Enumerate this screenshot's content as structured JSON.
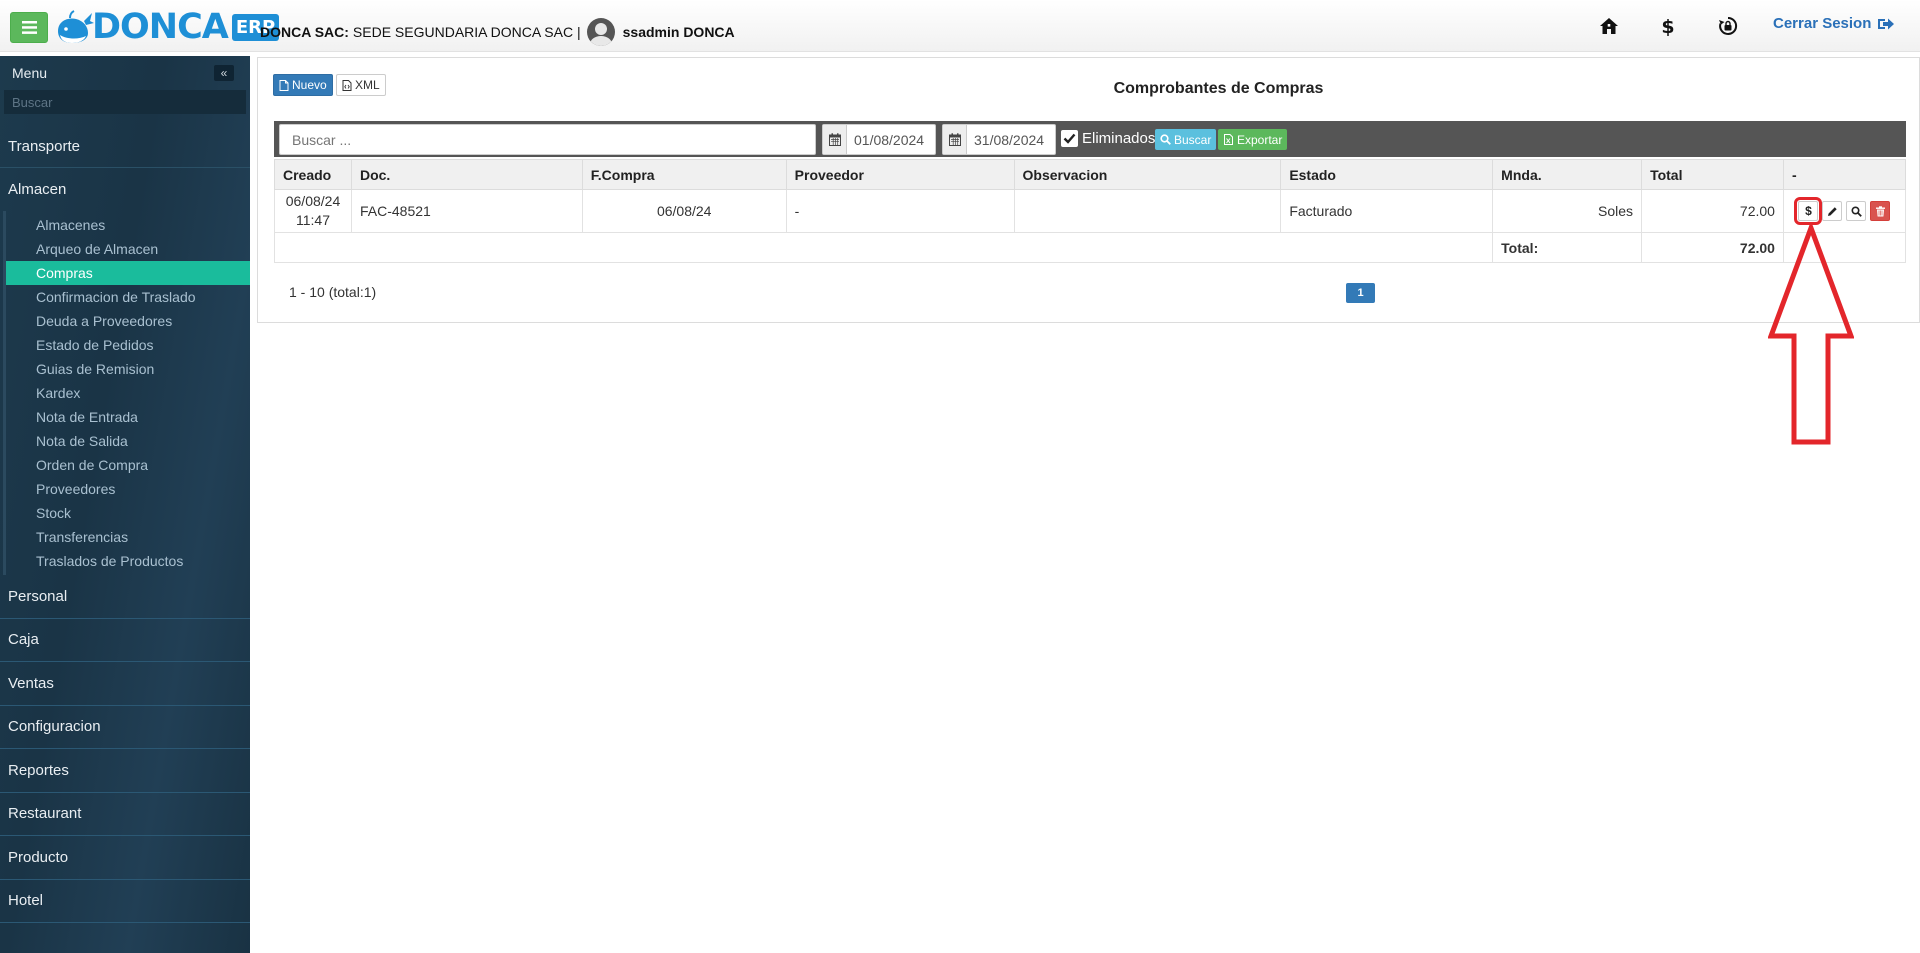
{
  "topbar": {
    "menu_icon": "hamburger-icon",
    "logo_text": "DONCA",
    "logo_badge": "ERP",
    "company_label": "DONCA SAC:",
    "branch": "SEDE SEGUNDARIA DONCA SAC |",
    "user": "ssadmin DONCA",
    "icons": [
      "home-icon",
      "dollar-icon",
      "lock-rotate-icon"
    ],
    "logout_label": "Cerrar Sesion"
  },
  "sidebar": {
    "title": "Menu",
    "collapse_icon": "double-chevron-left-icon",
    "search_placeholder": "Buscar",
    "top_items": [
      "Transporte",
      "Almacen"
    ],
    "almacen_items": [
      "Almacenes",
      "Arqueo de Almacen",
      "Compras",
      "Confirmacion de Traslado",
      "Deuda a Proveedores",
      "Estado de Pedidos",
      "Guias de Remision",
      "Kardex",
      "Nota de Entrada",
      "Nota de Salida",
      "Orden de Compra",
      "Proveedores",
      "Stock",
      "Transferencias",
      "Traslados de Productos"
    ],
    "active_item": "Compras",
    "bottom_items": [
      "Personal",
      "Caja",
      "Ventas",
      "Configuracion",
      "Reportes",
      "Restaurant",
      "Producto",
      "Hotel"
    ]
  },
  "panel": {
    "btn_nuevo": "Nuevo",
    "btn_xml": "XML",
    "title": "Comprobantes de Compras"
  },
  "filters": {
    "search_placeholder": "Buscar ...",
    "date_from": "01/08/2024",
    "date_to": "31/08/2024",
    "eliminados_label": "Eliminados",
    "eliminados_checked": true,
    "btn_buscar": "Buscar",
    "btn_exportar": "Exportar"
  },
  "table": {
    "headers": [
      "Creado",
      "Doc.",
      "F.Compra",
      "Proveedor",
      "Observacion",
      "Estado",
      "Mnda.",
      "Total",
      "-"
    ],
    "rows": [
      {
        "creado_date": "06/08/24",
        "creado_time": "11:47",
        "doc": "FAC-48521",
        "fcompra": "06/08/24",
        "proveedor": "-",
        "observacion": "",
        "estado": "Facturado",
        "moneda": "Soles",
        "total": "72.00",
        "actions": [
          "dollar-icon",
          "pencil-icon",
          "search-icon",
          "trash-icon"
        ]
      }
    ],
    "total_label": "Total:",
    "total_value": "72.00"
  },
  "pagination": {
    "info": "1 - 10 (total:1)",
    "current_page": "1"
  },
  "annotation": {
    "arrow_color": "#e3262b"
  }
}
